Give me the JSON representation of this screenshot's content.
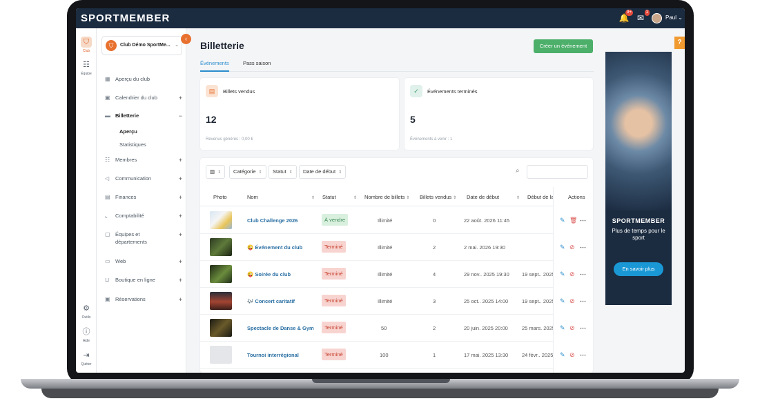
{
  "app": {
    "logo": "SPORTMEMBER",
    "user_name": "Paul",
    "notif_badge": "9+",
    "mail_badge": "1"
  },
  "rail": {
    "club": "Club",
    "team": "Équipe",
    "tools": "Outils",
    "help": "Aide",
    "quit": "Quitter"
  },
  "sidebar": {
    "club_name": "Club Démo SportMe...",
    "items": [
      {
        "label": "Aperçu du club",
        "plus": ""
      },
      {
        "label": "Calendrier du club",
        "plus": "+"
      },
      {
        "label": "Billetterie",
        "plus": "−"
      },
      {
        "label": "Membres",
        "plus": "+"
      },
      {
        "label": "Communication",
        "plus": "+"
      },
      {
        "label": "Finances",
        "plus": "+"
      },
      {
        "label": "Comptabilité",
        "plus": "+"
      },
      {
        "label": "Équipes et",
        "label2": "départements",
        "plus": "+"
      },
      {
        "label": "Web",
        "plus": "+"
      },
      {
        "label": "Boutique en ligne",
        "plus": "+"
      },
      {
        "label": "Réservations",
        "plus": "+"
      }
    ],
    "sub_items": [
      "Aperçu",
      "Statistiques"
    ]
  },
  "main": {
    "title": "Billetterie",
    "create_button": "Créer un événement",
    "tabs": [
      "Événements",
      "Pass saison"
    ],
    "cards": [
      {
        "title": "Billets vendus",
        "value": "12",
        "foot": "Revenus générés : 0,00 €"
      },
      {
        "title": "Événements terminés",
        "value": "5",
        "foot": "Événements à venir : 1"
      }
    ],
    "filters": [
      "Catégorie",
      "Statut",
      "Date de début"
    ],
    "columns": [
      "Photo",
      "Nom",
      "Statut",
      "Nombre de billets",
      "Billets vendus",
      "Date de début",
      "Début de la ve",
      "Actions"
    ],
    "rows": [
      {
        "name": "Club Challenge 2026",
        "status": "À vendre",
        "tickets": "Illimité",
        "sold": "0",
        "start": "22 août. 2026 11:45",
        "sale_start": ""
      },
      {
        "name": "😜 Événement du club",
        "status": "Terminé",
        "tickets": "Illimité",
        "sold": "2",
        "start": "2 mai. 2026 19:30",
        "sale_start": ""
      },
      {
        "name": "😜 Soirée du club",
        "status": "Terminé",
        "tickets": "Illimité",
        "sold": "4",
        "start": "29 nov.. 2025 19:30",
        "sale_start": "19 sept.. 2025"
      },
      {
        "name": "🎶 Concert caritatif",
        "status": "Terminé",
        "tickets": "Illimité",
        "sold": "3",
        "start": "25 oct.. 2025 14:00",
        "sale_start": "19 sept.. 2025"
      },
      {
        "name": "Spectacle de Danse & Gym",
        "status": "Terminé",
        "tickets": "50",
        "sold": "2",
        "start": "20 juin. 2025 20:00",
        "sale_start": "25 mars. 2025"
      },
      {
        "name": "Tournoi interrégional",
        "status": "Terminé",
        "tickets": "100",
        "sold": "1",
        "start": "17 mai. 2025 13:30",
        "sale_start": "24 févr.. 2025"
      }
    ]
  },
  "ad": {
    "logo": "SPORTMEMBER",
    "tagline": "Plus de temps pour le sport",
    "button": "En savoir plus"
  },
  "help_tab": "?",
  "colors": {
    "topbar": "#1b2b40",
    "accent_orange": "#e8712f",
    "primary_blue": "#2b8dcc",
    "success_green": "#4caf6a",
    "danger_red": "#c7412f"
  }
}
